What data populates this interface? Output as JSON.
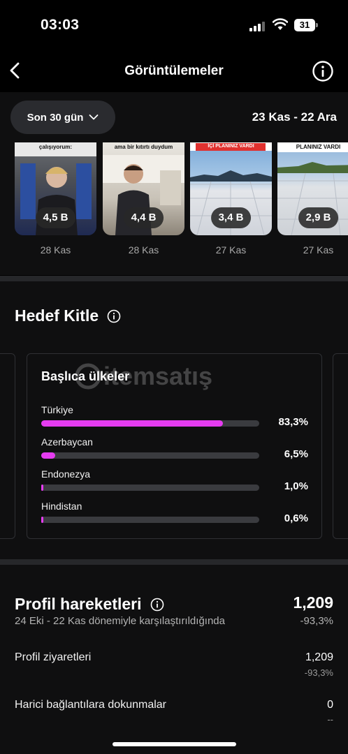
{
  "status_bar": {
    "time": "03:03",
    "battery": "31"
  },
  "nav": {
    "title": "Görüntülemeler",
    "back_icon": "chevron-left-icon",
    "info_icon": "info-icon"
  },
  "filter": {
    "period_label": "Son 30 gün",
    "date_range": "23 Kas - 22 Ara"
  },
  "thumbnails": [
    {
      "caption": "çalışıyorum:",
      "views": "4,5 B",
      "date": "28 Kas"
    },
    {
      "caption": "ama bir kıtırtı duydum",
      "views": "4,4 B",
      "date": "28 Kas"
    },
    {
      "caption": "İÇİ PLANINIZ VARDI",
      "views": "3,4 B",
      "date": "27 Kas"
    },
    {
      "caption": "PLANINIZ VARDI",
      "views": "2,9 B",
      "date": "27 Kas"
    }
  ],
  "audience": {
    "title": "Hedef Kitle",
    "card_title": "Başlıca ülkeler",
    "countries": [
      {
        "name": "Türkiye",
        "percent_label": "83,3%",
        "fraction": 0.833
      },
      {
        "name": "Azerbaycan",
        "percent_label": "6,5%",
        "fraction": 0.065
      },
      {
        "name": "Endonezya",
        "percent_label": "1,0%",
        "fraction": 0.01
      },
      {
        "name": "Hindistan",
        "percent_label": "0,6%",
        "fraction": 0.006
      }
    ],
    "watermark": "itemsatış"
  },
  "profile": {
    "title": "Profil hareketleri",
    "total": "1,209",
    "compare_text": "24 Eki - 22 Kas dönemiyle karşılaştırıldığında",
    "compare_pct": "-93,3%",
    "metrics": [
      {
        "label": "Profil ziyaretleri",
        "value": "1,209",
        "change": "-93,3%"
      },
      {
        "label": "Harici bağlantılara dokunmalar",
        "value": "0",
        "change": "--"
      }
    ]
  },
  "colors": {
    "accent_bar": "#e53cf0",
    "background": "#000000",
    "panel": "#0f0f10"
  }
}
